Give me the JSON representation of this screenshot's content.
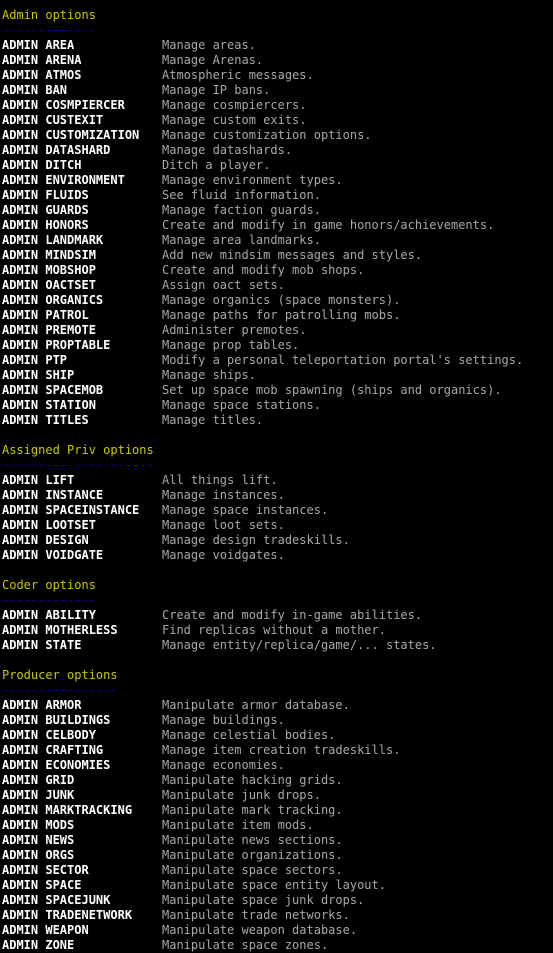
{
  "terminal": {
    "background_color": "#000000",
    "heading_color": "#c8c800",
    "rule_color": "#0000c8",
    "command_color": "#ffffff",
    "description_color": "#a8a8a8",
    "rule_character": "-"
  },
  "sections": [
    {
      "title": "Admin options",
      "rule": "-------------",
      "commands": [
        {
          "name": "ADMIN AREA",
          "desc": "Manage areas."
        },
        {
          "name": "ADMIN ARENA",
          "desc": "Manage Arenas."
        },
        {
          "name": "ADMIN ATMOS",
          "desc": "Atmospheric messages."
        },
        {
          "name": "ADMIN BAN",
          "desc": "Manage IP bans."
        },
        {
          "name": "ADMIN COSMPIERCER",
          "desc": "Manage cosmpiercers."
        },
        {
          "name": "ADMIN CUSTEXIT",
          "desc": "Manage custom exits."
        },
        {
          "name": "ADMIN CUSTOMIZATION",
          "desc": "Manage customization options."
        },
        {
          "name": "ADMIN DATASHARD",
          "desc": "Manage datashards."
        },
        {
          "name": "ADMIN DITCH",
          "desc": "Ditch a player."
        },
        {
          "name": "ADMIN ENVIRONMENT",
          "desc": "Manage environment types."
        },
        {
          "name": "ADMIN FLUIDS",
          "desc": "See fluid information."
        },
        {
          "name": "ADMIN GUARDS",
          "desc": "Manage faction guards."
        },
        {
          "name": "ADMIN HONORS",
          "desc": "Create and modify in game honors/achievements."
        },
        {
          "name": "ADMIN LANDMARK",
          "desc": "Manage area landmarks."
        },
        {
          "name": "ADMIN MINDSIM",
          "desc": "Add new mindsim messages and styles."
        },
        {
          "name": "ADMIN MOBSHOP",
          "desc": "Create and modify mob shops."
        },
        {
          "name": "ADMIN OACTSET",
          "desc": "Assign oact sets."
        },
        {
          "name": "ADMIN ORGANICS",
          "desc": "Manage organics (space monsters)."
        },
        {
          "name": "ADMIN PATROL",
          "desc": "Manage paths for patrolling mobs."
        },
        {
          "name": "ADMIN PREMOTE",
          "desc": "Administer premotes."
        },
        {
          "name": "ADMIN PROPTABLE",
          "desc": "Manage prop tables."
        },
        {
          "name": "ADMIN PTP",
          "desc": "Modify a personal teleportation portal's settings."
        },
        {
          "name": "ADMIN SHIP",
          "desc": "Manage ships."
        },
        {
          "name": "ADMIN SPACEMOB",
          "desc": "Set up space mob spawning (ships and organics)."
        },
        {
          "name": "ADMIN STATION",
          "desc": "Manage space stations."
        },
        {
          "name": "ADMIN TITLES",
          "desc": "Manage titles."
        }
      ]
    },
    {
      "title": "Assigned Priv options",
      "rule": "---------------------",
      "commands": [
        {
          "name": "ADMIN LIFT",
          "desc": "All things lift."
        },
        {
          "name": "ADMIN INSTANCE",
          "desc": "Manage instances."
        },
        {
          "name": "ADMIN SPACEINSTANCE",
          "desc": "Manage space instances."
        },
        {
          "name": "ADMIN LOOTSET",
          "desc": "Manage loot sets."
        },
        {
          "name": "ADMIN DESIGN",
          "desc": "Manage design tradeskills."
        },
        {
          "name": "ADMIN VOIDGATE",
          "desc": "Manage voidgates."
        }
      ]
    },
    {
      "title": "Coder options",
      "rule": "-------------",
      "commands": [
        {
          "name": "ADMIN ABILITY",
          "desc": "Create and modify in-game abilities."
        },
        {
          "name": "ADMIN MOTHERLESS",
          "desc": "Find replicas without a mother."
        },
        {
          "name": "ADMIN STATE",
          "desc": "Manage entity/replica/game/... states."
        }
      ]
    },
    {
      "title": "Producer options",
      "rule": "----------------",
      "commands": [
        {
          "name": "ADMIN ARMOR",
          "desc": "Manipulate armor database."
        },
        {
          "name": "ADMIN BUILDINGS",
          "desc": "Manage buildings."
        },
        {
          "name": "ADMIN CELBODY",
          "desc": "Manage celestial bodies."
        },
        {
          "name": "ADMIN CRAFTING",
          "desc": "Manage item creation tradeskills."
        },
        {
          "name": "ADMIN ECONOMIES",
          "desc": "Manage economies."
        },
        {
          "name": "ADMIN GRID",
          "desc": "Manipulate hacking grids."
        },
        {
          "name": "ADMIN JUNK",
          "desc": "Manipulate junk drops."
        },
        {
          "name": "ADMIN MARKTRACKING",
          "desc": "Manipulate mark tracking."
        },
        {
          "name": "ADMIN MODS",
          "desc": "Manipulate item mods."
        },
        {
          "name": "ADMIN NEWS",
          "desc": "Manipulate news sections."
        },
        {
          "name": "ADMIN ORGS",
          "desc": "Manipulate organizations."
        },
        {
          "name": "ADMIN SECTOR",
          "desc": "Manipulate space sectors."
        },
        {
          "name": "ADMIN SPACE",
          "desc": "Manipulate space entity layout."
        },
        {
          "name": "ADMIN SPACEJUNK",
          "desc": "Manipulate space junk drops."
        },
        {
          "name": "ADMIN TRADENETWORK",
          "desc": "Manipulate trade networks."
        },
        {
          "name": "ADMIN WEAPON",
          "desc": "Manipulate weapon database."
        },
        {
          "name": "ADMIN ZONE",
          "desc": "Manipulate space zones."
        }
      ]
    }
  ]
}
